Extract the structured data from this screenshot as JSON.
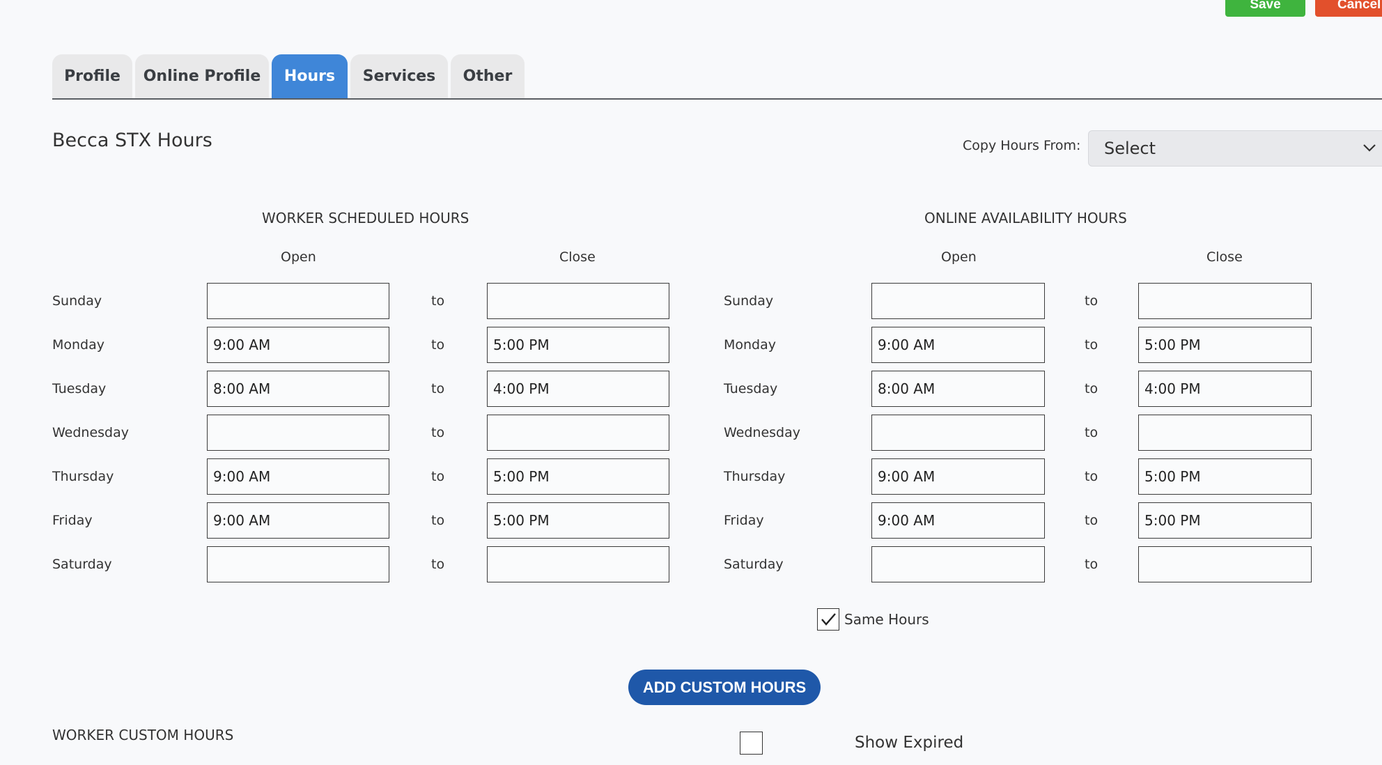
{
  "actions": {
    "save_label": "Save",
    "cancel_label": "Cancel"
  },
  "tabs": [
    {
      "label": "Profile",
      "active": false
    },
    {
      "label": "Online Profile",
      "active": false
    },
    {
      "label": "Hours",
      "active": true
    },
    {
      "label": "Services",
      "active": false
    },
    {
      "label": "Other",
      "active": false
    }
  ],
  "page_title": "Becca STX Hours",
  "copy_hours": {
    "label": "Copy Hours From:",
    "selected": "Select"
  },
  "worker": {
    "title": "WORKER SCHEDULED HOURS",
    "open_label": "Open",
    "close_label": "Close",
    "rows": [
      {
        "day": "Sunday",
        "open": "",
        "close": ""
      },
      {
        "day": "Monday",
        "open": "9:00 AM",
        "close": "5:00 PM"
      },
      {
        "day": "Tuesday",
        "open": "8:00 AM",
        "close": "4:00 PM"
      },
      {
        "day": "Wednesday",
        "open": "",
        "close": ""
      },
      {
        "day": "Thursday",
        "open": "9:00 AM",
        "close": "5:00 PM"
      },
      {
        "day": "Friday",
        "open": "9:00 AM",
        "close": "5:00 PM"
      },
      {
        "day": "Saturday",
        "open": "",
        "close": ""
      }
    ]
  },
  "online": {
    "title": "ONLINE AVAILABILITY HOURS",
    "open_label": "Open",
    "close_label": "Close",
    "rows": [
      {
        "day": "Sunday",
        "open": "",
        "close": ""
      },
      {
        "day": "Monday",
        "open": "9:00 AM",
        "close": "5:00 PM"
      },
      {
        "day": "Tuesday",
        "open": "8:00 AM",
        "close": "4:00 PM"
      },
      {
        "day": "Wednesday",
        "open": "",
        "close": ""
      },
      {
        "day": "Thursday",
        "open": "9:00 AM",
        "close": "5:00 PM"
      },
      {
        "day": "Friday",
        "open": "9:00 AM",
        "close": "5:00 PM"
      },
      {
        "day": "Saturday",
        "open": "",
        "close": ""
      }
    ]
  },
  "to_label": "to",
  "same_hours": {
    "label": "Same Hours",
    "checked": true
  },
  "add_custom_label": "ADD CUSTOM HOURS",
  "custom_title": "WORKER CUSTOM HOURS",
  "show_expired": {
    "label": "Show Expired",
    "checked": false
  }
}
